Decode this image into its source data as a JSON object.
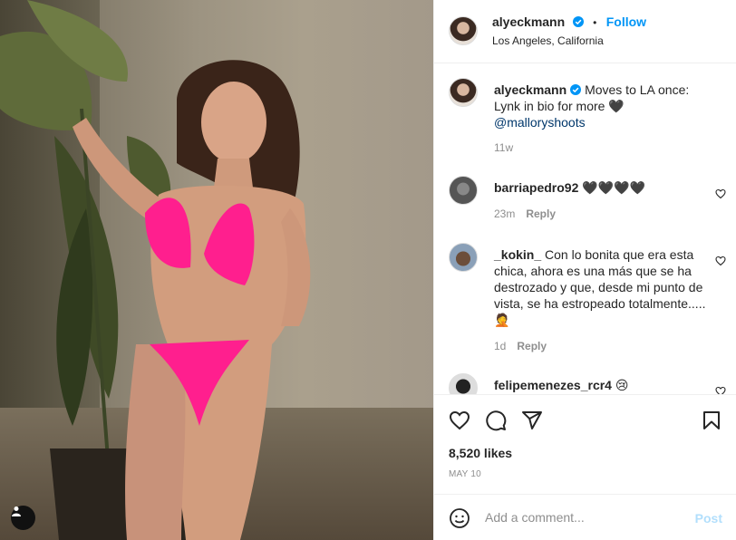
{
  "post": {
    "author": "alyeckmann",
    "location": "Los Angeles, California",
    "follow_label": "Follow",
    "dot": "•",
    "caption_text": "Moves to LA once: Lynk in bio for more 🖤",
    "caption_mention": "@malloryshoots",
    "caption_age": "11w"
  },
  "comments": [
    {
      "user": "barriapedro92",
      "text": "🖤🖤🖤🖤",
      "age": "23m",
      "reply_label": "Reply",
      "avatar_icon": "avatar-placeholder"
    },
    {
      "user": "_kokin_",
      "text": "Con lo bonita que era esta chica, ahora es una más que se ha destrozado y que, desde mi punto de vista, se ha estropeado totalmente.....🤦",
      "age": "1d",
      "reply_label": "Reply",
      "avatar_icon": "avatar-photo"
    },
    {
      "user": "felipemenezes_rcr4",
      "text": "😢",
      "age": "",
      "reply_label": "",
      "avatar_icon": "avatar-photo"
    }
  ],
  "stats": {
    "likes": "8,520 likes",
    "date": "MAY 10"
  },
  "add_comment": {
    "placeholder": "Add a comment...",
    "post_label": "Post"
  },
  "colors": {
    "accent": "#0095f6",
    "post_disabled": "#b2dffc",
    "muted": "#8e8e8e",
    "text": "#262626"
  },
  "icons": [
    "verified-badge-icon",
    "heart-icon",
    "comment-icon",
    "share-icon",
    "bookmark-icon",
    "emoji-icon",
    "user-tag-icon"
  ]
}
